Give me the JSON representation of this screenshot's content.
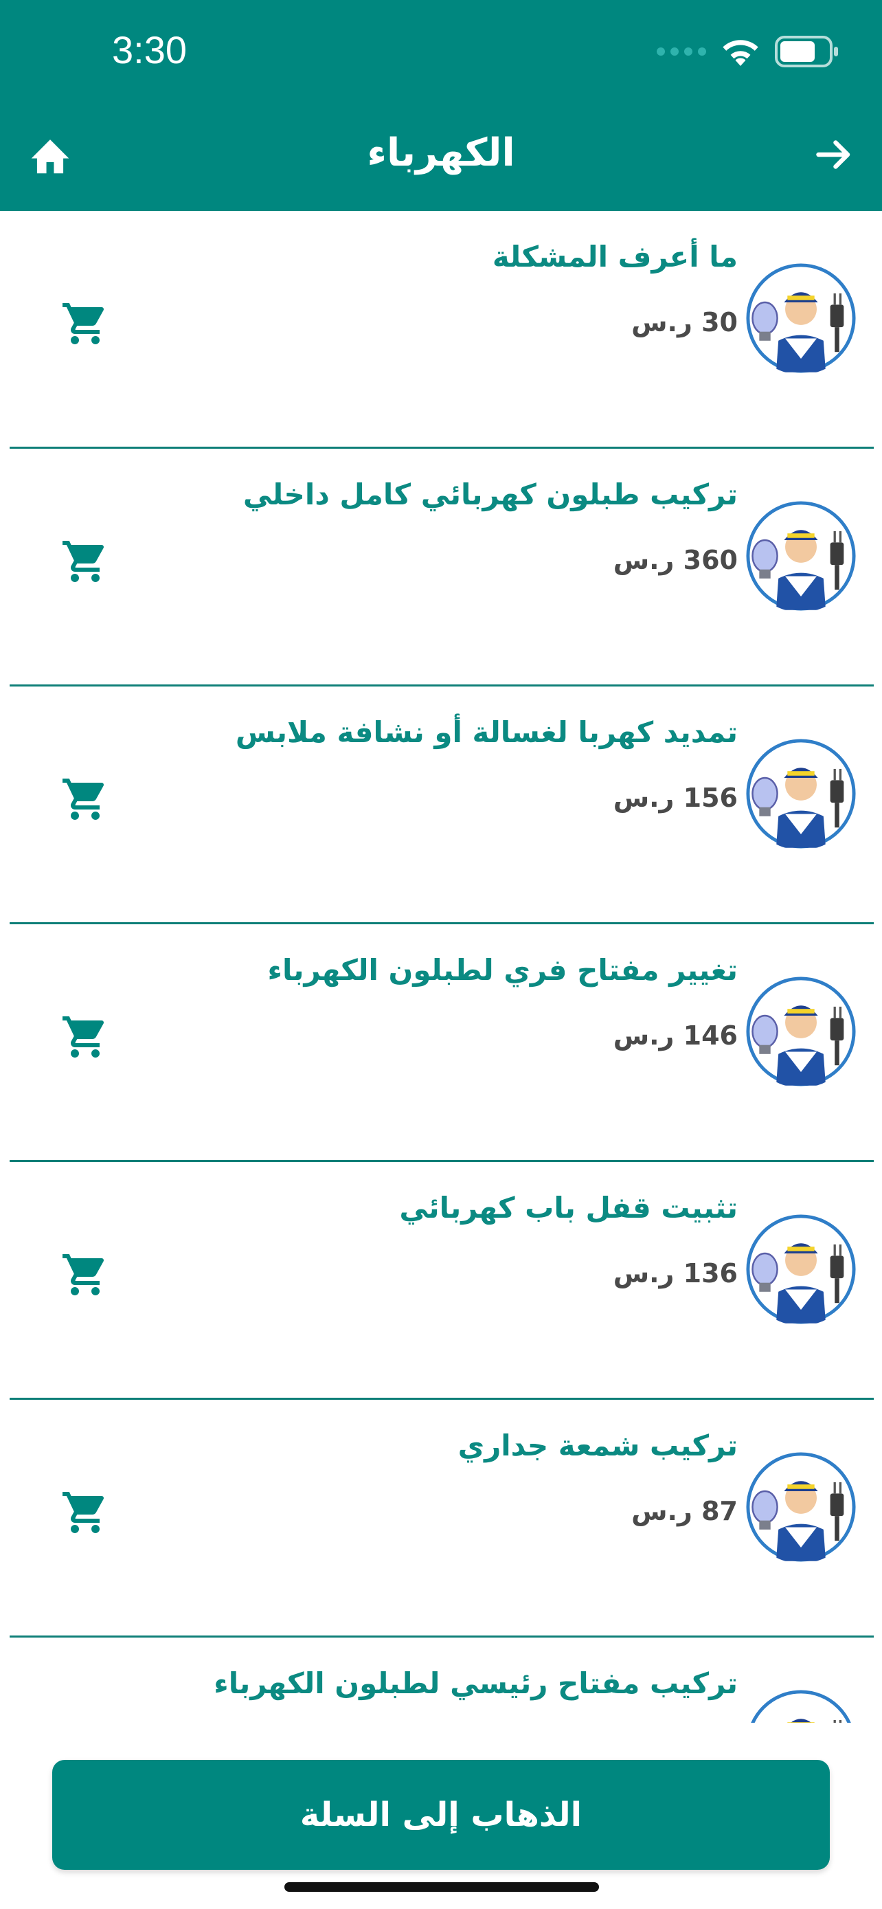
{
  "status_bar": {
    "time": "3:30"
  },
  "header": {
    "title": "الكهرباء",
    "home_icon": "home-icon",
    "back_icon": "arrow-right-icon"
  },
  "items": [
    {
      "title": "ما أعرف المشكلة",
      "price": "30 ر.س"
    },
    {
      "title": "تركيب طبلون كهربائي كامل داخلي",
      "price": "360 ر.س"
    },
    {
      "title": "تمديد كهربا لغسالة أو نشافة ملابس",
      "price": "156 ر.س"
    },
    {
      "title": "تغيير مفتاح فري لطبلون الكهرباء",
      "price": "146 ر.س"
    },
    {
      "title": "تثبيت قفل باب كهربائي",
      "price": "136 ر.س"
    },
    {
      "title": "تركيب شمعة جداري",
      "price": "87 ر.س"
    },
    {
      "title": "تركيب مفتاح رئيسي لطبلون الكهرباء",
      "price": ""
    }
  ],
  "footer": {
    "go_to_cart": "الذهاب إلى السلة"
  },
  "colors": {
    "primary": "#00877f",
    "accent_text": "#0b8a82"
  }
}
